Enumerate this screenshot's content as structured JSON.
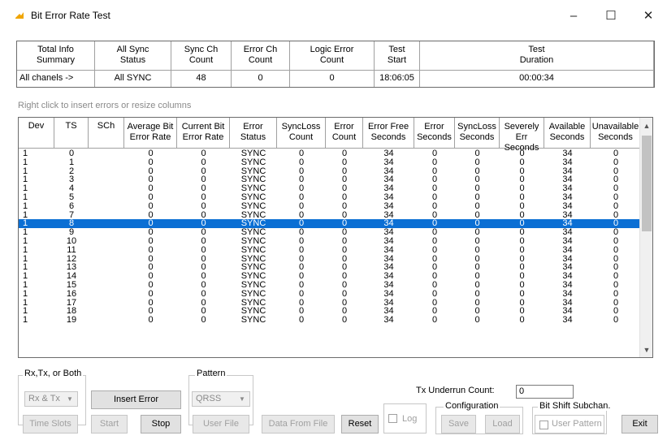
{
  "window": {
    "title": "Bit Error Rate Test"
  },
  "summary": {
    "headers": [
      "Total Info\nSummary",
      "All Sync\nStatus",
      "Sync Ch\nCount",
      "Error Ch\nCount",
      "Logic Error\nCount",
      "Test\nStart",
      "Test\nDuration"
    ],
    "values": [
      "All chanels ->",
      "All SYNC",
      "48",
      "0",
      "0",
      "18:06:05",
      "00:00:34"
    ]
  },
  "hint": "Right click to insert errors or resize columns",
  "grid": {
    "columns": [
      "Dev",
      "TS",
      "SCh",
      "Average Bit\nError Rate",
      "Current Bit\nError Rate",
      "Error\nStatus",
      "SyncLoss\nCount",
      "Error\nCount",
      "Error Free\nSeconds",
      "Error\nSeconds",
      "SyncLoss\nSeconds",
      "Severely Err\nSeconds",
      "Available\nSeconds",
      "Unavailable\nSeconds"
    ],
    "rows": [
      [
        "1",
        "0",
        "",
        "0",
        "0",
        "SYNC",
        "0",
        "0",
        "34",
        "0",
        "0",
        "0",
        "34",
        "0"
      ],
      [
        "1",
        "1",
        "",
        "0",
        "0",
        "SYNC",
        "0",
        "0",
        "34",
        "0",
        "0",
        "0",
        "34",
        "0"
      ],
      [
        "1",
        "2",
        "",
        "0",
        "0",
        "SYNC",
        "0",
        "0",
        "34",
        "0",
        "0",
        "0",
        "34",
        "0"
      ],
      [
        "1",
        "3",
        "",
        "0",
        "0",
        "SYNC",
        "0",
        "0",
        "34",
        "0",
        "0",
        "0",
        "34",
        "0"
      ],
      [
        "1",
        "4",
        "",
        "0",
        "0",
        "SYNC",
        "0",
        "0",
        "34",
        "0",
        "0",
        "0",
        "34",
        "0"
      ],
      [
        "1",
        "5",
        "",
        "0",
        "0",
        "SYNC",
        "0",
        "0",
        "34",
        "0",
        "0",
        "0",
        "34",
        "0"
      ],
      [
        "1",
        "6",
        "",
        "0",
        "0",
        "SYNC",
        "0",
        "0",
        "34",
        "0",
        "0",
        "0",
        "34",
        "0"
      ],
      [
        "1",
        "7",
        "",
        "0",
        "0",
        "SYNC",
        "0",
        "0",
        "34",
        "0",
        "0",
        "0",
        "34",
        "0"
      ],
      [
        "1",
        "8",
        "",
        "0",
        "0",
        "SYNC",
        "0",
        "0",
        "34",
        "0",
        "0",
        "0",
        "34",
        "0"
      ],
      [
        "1",
        "9",
        "",
        "0",
        "0",
        "SYNC",
        "0",
        "0",
        "34",
        "0",
        "0",
        "0",
        "34",
        "0"
      ],
      [
        "1",
        "10",
        "",
        "0",
        "0",
        "SYNC",
        "0",
        "0",
        "34",
        "0",
        "0",
        "0",
        "34",
        "0"
      ],
      [
        "1",
        "11",
        "",
        "0",
        "0",
        "SYNC",
        "0",
        "0",
        "34",
        "0",
        "0",
        "0",
        "34",
        "0"
      ],
      [
        "1",
        "12",
        "",
        "0",
        "0",
        "SYNC",
        "0",
        "0",
        "34",
        "0",
        "0",
        "0",
        "34",
        "0"
      ],
      [
        "1",
        "13",
        "",
        "0",
        "0",
        "SYNC",
        "0",
        "0",
        "34",
        "0",
        "0",
        "0",
        "34",
        "0"
      ],
      [
        "1",
        "14",
        "",
        "0",
        "0",
        "SYNC",
        "0",
        "0",
        "34",
        "0",
        "0",
        "0",
        "34",
        "0"
      ],
      [
        "1",
        "15",
        "",
        "0",
        "0",
        "SYNC",
        "0",
        "0",
        "34",
        "0",
        "0",
        "0",
        "34",
        "0"
      ],
      [
        "1",
        "16",
        "",
        "0",
        "0",
        "SYNC",
        "0",
        "0",
        "34",
        "0",
        "0",
        "0",
        "34",
        "0"
      ],
      [
        "1",
        "17",
        "",
        "0",
        "0",
        "SYNC",
        "0",
        "0",
        "34",
        "0",
        "0",
        "0",
        "34",
        "0"
      ],
      [
        "1",
        "18",
        "",
        "0",
        "0",
        "SYNC",
        "0",
        "0",
        "34",
        "0",
        "0",
        "0",
        "34",
        "0"
      ],
      [
        "1",
        "19",
        "",
        "0",
        "0",
        "SYNC",
        "0",
        "0",
        "34",
        "0",
        "0",
        "0",
        "34",
        "0"
      ]
    ],
    "selected_row": 8
  },
  "controls": {
    "rxtx_group": "Rx,Tx, or Both",
    "rxtx_value": "Rx & Tx",
    "insert_error": "Insert Error",
    "pattern_group": "Pattern",
    "pattern_value": "QRSS",
    "time_slots": "Time Slots",
    "start": "Start",
    "stop": "Stop",
    "user_file": "User File",
    "data_from_file": "Data From File",
    "reset": "Reset",
    "log": "Log",
    "tx_underrun_label": "Tx Underrun Count:",
    "tx_underrun_value": "0",
    "configuration_group": "Configuration",
    "save": "Save",
    "load": "Load",
    "bit_shift_group": "Bit Shift Subchan.",
    "user_pattern": "User Pattern",
    "exit": "Exit"
  },
  "colors": {
    "selection": "#0b6fd4",
    "icon": "#f0a500"
  }
}
